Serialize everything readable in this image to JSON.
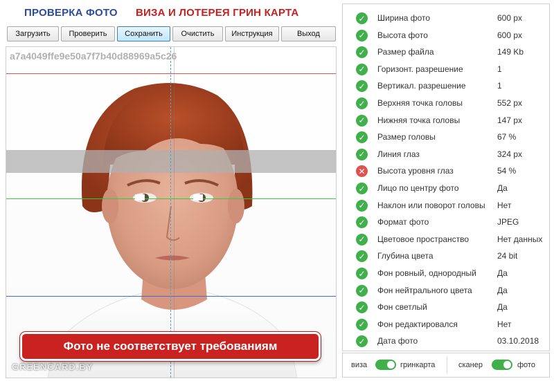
{
  "header": {
    "title_left": "ПРОВЕРКА ФОТО",
    "title_right": "ВИЗА И ЛОТЕРЕЯ ГРИН КАРТА"
  },
  "toolbar": {
    "buttons": [
      {
        "label": "Загрузить"
      },
      {
        "label": "Проверить"
      },
      {
        "label": "Сохранить",
        "active": true
      },
      {
        "label": "Очистить"
      },
      {
        "label": "Инструкция"
      },
      {
        "label": "Выход"
      }
    ]
  },
  "photo": {
    "hash": "a7a4049ffe9e50a7f7b40d88969a5c26",
    "watermark": "GREENCARD.BY",
    "warning": "Фото не соответствует требованиям"
  },
  "checks": [
    {
      "label": "Ширина фото",
      "value": "600 px",
      "status": "ok"
    },
    {
      "label": "Высота фото",
      "value": "600 px",
      "status": "ok"
    },
    {
      "label": "Размер файла",
      "value": "149 Kb",
      "status": "ok"
    },
    {
      "label": "Горизонт. разрешение",
      "value": "1",
      "status": "ok"
    },
    {
      "label": "Вертикал. разрешение",
      "value": "1",
      "status": "ok"
    },
    {
      "label": "Верхняя точка головы",
      "value": "552 px",
      "status": "ok"
    },
    {
      "label": "Нижняя точка головы",
      "value": "147 px",
      "status": "ok"
    },
    {
      "label": "Размер головы",
      "value": "67 %",
      "status": "ok"
    },
    {
      "label": "Линия глаз",
      "value": "324 px",
      "status": "ok"
    },
    {
      "label": "Высота уровня глаз",
      "value": "54 %",
      "status": "fail"
    },
    {
      "label": "Лицо по центру фото",
      "value": "Да",
      "status": "ok"
    },
    {
      "label": "Наклон или поворот головы",
      "value": "Нет",
      "status": "ok"
    },
    {
      "label": "Формат фото",
      "value": "JPEG",
      "status": "ok"
    },
    {
      "label": "Цветовое пространство",
      "value": "Нет данных",
      "status": "ok"
    },
    {
      "label": "Глубина цвета",
      "value": "24 bit",
      "status": "ok"
    },
    {
      "label": "Фон ровный, однородный",
      "value": "Да",
      "status": "ok"
    },
    {
      "label": "Фон нейтрального цвета",
      "value": "Да",
      "status": "ok"
    },
    {
      "label": "Фон светлый",
      "value": "Да",
      "status": "ok"
    },
    {
      "label": "Фон редактировался",
      "value": "Нет",
      "status": "ok"
    },
    {
      "label": "Дата фото",
      "value": "03.10.2018",
      "status": "ok"
    }
  ],
  "toggles": {
    "left": {
      "label_off": "виза",
      "label_on": "гринкарта",
      "on": true
    },
    "right": {
      "label_off": "сканер",
      "label_on": "фото",
      "on": true
    }
  },
  "colors": {
    "ok": "#3fb04a",
    "fail": "#e05252",
    "title_blue": "#2b4c9e",
    "title_red": "#c8201d",
    "warning_bg": "#c92221"
  },
  "icons": {
    "ok": "check-circle-icon",
    "fail": "x-circle-icon"
  }
}
